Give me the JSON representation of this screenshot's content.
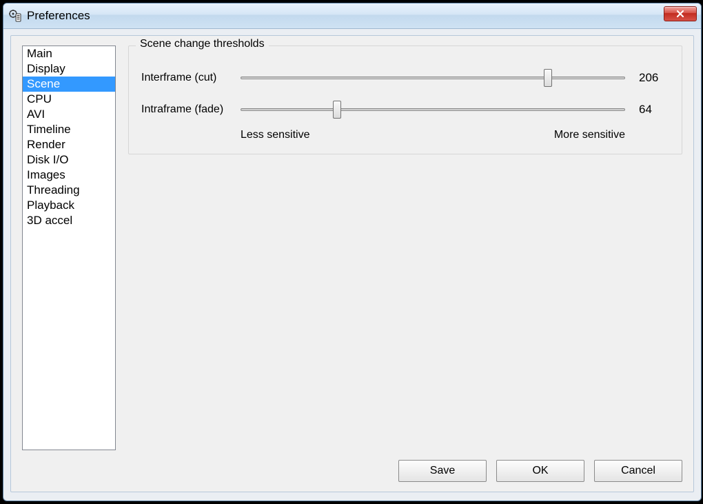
{
  "window": {
    "title": "Preferences"
  },
  "sidebar": {
    "items": [
      {
        "label": "Main",
        "selected": false
      },
      {
        "label": "Display",
        "selected": false
      },
      {
        "label": "Scene",
        "selected": true
      },
      {
        "label": "CPU",
        "selected": false
      },
      {
        "label": "AVI",
        "selected": false
      },
      {
        "label": "Timeline",
        "selected": false
      },
      {
        "label": "Render",
        "selected": false
      },
      {
        "label": "Disk I/O",
        "selected": false
      },
      {
        "label": "Images",
        "selected": false
      },
      {
        "label": "Threading",
        "selected": false
      },
      {
        "label": "Playback",
        "selected": false
      },
      {
        "label": "3D accel",
        "selected": false
      }
    ]
  },
  "main": {
    "group_title": "Scene change thresholds",
    "sliders": {
      "interframe": {
        "label": "Interframe (cut)",
        "value": 206,
        "min": 0,
        "max": 256,
        "percent": 80
      },
      "intraframe": {
        "label": "Intraframe (fade)",
        "value": 64,
        "min": 0,
        "max": 256,
        "percent": 25
      }
    },
    "caption_left": "Less sensitive",
    "caption_right": "More sensitive"
  },
  "buttons": {
    "save": "Save",
    "ok": "OK",
    "cancel": "Cancel"
  }
}
